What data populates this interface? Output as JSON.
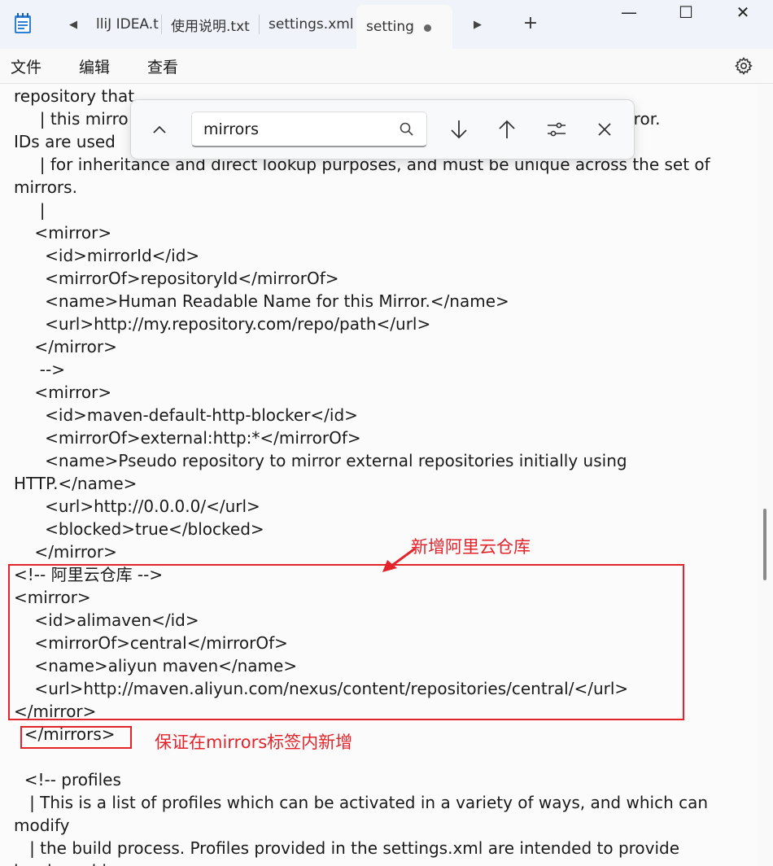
{
  "tabs": [
    {
      "label": "lliJ IDEA.t"
    },
    {
      "label": "使用说明.txt"
    },
    {
      "label": "settings.xml"
    },
    {
      "label": "setting"
    }
  ],
  "window": {
    "minimize": "—",
    "maximize": "☐",
    "close": "✕"
  },
  "menu": {
    "file": "文件",
    "edit": "编辑",
    "view": "查看"
  },
  "find": {
    "query": "mirrors"
  },
  "editor_lines": [
    "repository that",
    "     | this mirro                                                                                       his mirror.",
    "IDs are used",
    "     | for inheritance and direct lookup purposes, and must be unique across the set of",
    "mirrors.",
    "     |",
    "    <mirror>",
    "      <id>mirrorId</id>",
    "      <mirrorOf>repositoryId</mirrorOf>",
    "      <name>Human Readable Name for this Mirror.</name>",
    "      <url>http://my.repository.com/repo/path</url>",
    "    </mirror>",
    "     -->",
    "    <mirror>",
    "      <id>maven-default-http-blocker</id>",
    "      <mirrorOf>external:http:*</mirrorOf>",
    "      <name>Pseudo repository to mirror external repositories initially using",
    "HTTP.</name>",
    "      <url>http://0.0.0.0/</url>",
    "      <blocked>true</blocked>",
    "    </mirror>",
    "<!-- 阿里云仓库 -->",
    "<mirror>",
    "    <id>alimaven</id>",
    "    <mirrorOf>central</mirrorOf>",
    "    <name>aliyun maven</name>",
    "    <url>http://maven.aliyun.com/nexus/content/repositories/central/</url>",
    "</mirror>",
    "  </mirrors>",
    "",
    "  <!-- profiles",
    "   | This is a list of profiles which can be activated in a variety of ways, and which can",
    "modify",
    "   | the build process. Profiles provided in the settings.xml are intended to provide",
    "local machine-"
  ],
  "annotations": {
    "add_repo": "新增阿里云仓库",
    "inside_mirrors": "保证在mirrors标签内新增"
  },
  "colors": {
    "annotation": "#e3242b",
    "accent": "#0067c0"
  },
  "icons": [
    "notepad-icon",
    "tab-scroll-left-icon",
    "tab-scroll-right-icon",
    "new-tab-icon",
    "gear-icon",
    "chevron-up-icon",
    "search-icon",
    "arrow-down-icon",
    "arrow-up-icon",
    "options-icon",
    "close-icon"
  ]
}
